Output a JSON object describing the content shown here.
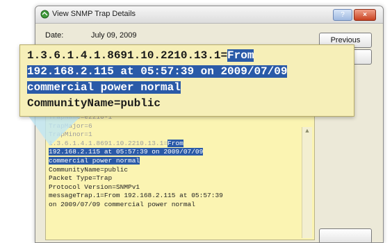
{
  "window": {
    "title": "View SNMP Trap Details",
    "date_label": "Date:",
    "date_value": "July 09, 2009",
    "buttons": {
      "previous": "Previous",
      "next": "",
      "bottom": ""
    }
  },
  "callout": {
    "lines": [
      {
        "plain": "1.3.6.1.4.1.8691.10.2210.13.1=",
        "selected": "From"
      },
      {
        "plain": "",
        "selected": "192.168.2.115 at 05:57:39 on 2009/07/09"
      },
      {
        "plain": "",
        "selected": "commercial power normal"
      },
      {
        "plain": "CommunityName=public",
        "selected": ""
      }
    ]
  },
  "textarea": {
    "faded_lines": [
      "TrapName=e2210-1",
      "TrapMajor=6",
      "TrapMinor=1"
    ],
    "selection": {
      "oid_prefix": "1.3.6.1.4.1.8691.10.2210.13.1=",
      "line1": "From",
      "line2": "192.168.2.115 at 05:57:39 on 2009/07/09",
      "line3": "commercial power normal"
    },
    "lines": [
      "CommunityName=public",
      "Packet Type=Trap",
      "Protocol Version=SNMPv1",
      "messageTrap.1=From 192.168.2.115 at 05:57:39",
      "on 2009/07/09 commercial power normal"
    ]
  },
  "colors": {
    "selection": "#2a5aa8",
    "note_background": "#fbf4b2",
    "callout_background": "#f6efb8"
  }
}
